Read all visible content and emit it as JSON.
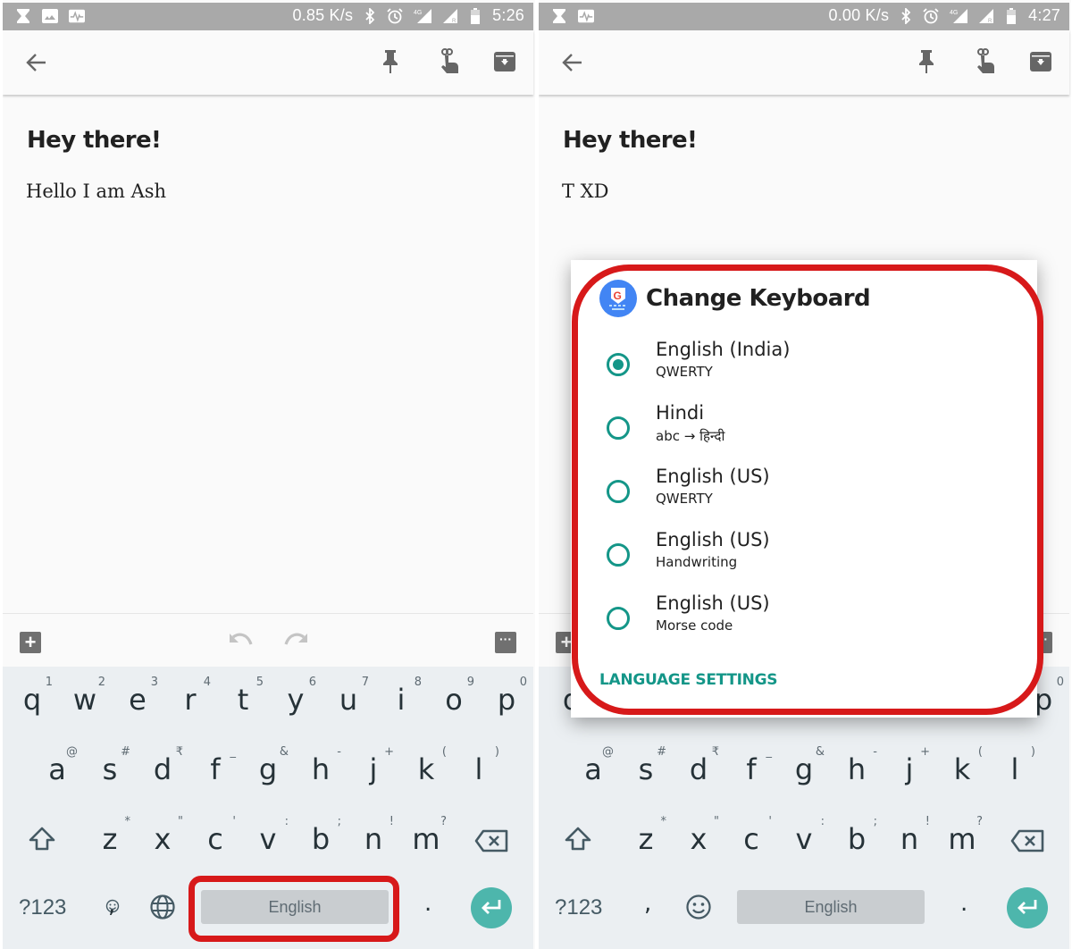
{
  "colors": {
    "accent": "#149688",
    "enter_key": "#4db6ac",
    "highlight": "#d7191a",
    "statusbar": "#a9a9a9",
    "keyboard_bg": "#ebeff2"
  },
  "left": {
    "statusbar": {
      "left_icons": [
        "hourglass-icon",
        "image-icon",
        "activity-icon"
      ],
      "net_speed": "0.85 K/s",
      "right_icons": [
        "bluetooth-icon",
        "alarm-icon",
        "4g-signal-icon",
        "roaming-signal-icon",
        "battery-icon"
      ],
      "network_label": "4G",
      "time": "5:26"
    },
    "toolbar": {
      "icons": [
        "back-arrow-icon",
        "pin-icon",
        "reminder-icon",
        "archive-icon"
      ]
    },
    "note": {
      "title": "Hey there!",
      "body": "Hello I am Ash"
    },
    "keyboard": {
      "row1": [
        {
          "key": "q",
          "hint": "1"
        },
        {
          "key": "w",
          "hint": "2"
        },
        {
          "key": "e",
          "hint": "3"
        },
        {
          "key": "r",
          "hint": "4"
        },
        {
          "key": "t",
          "hint": "5"
        },
        {
          "key": "y",
          "hint": "6"
        },
        {
          "key": "u",
          "hint": "7"
        },
        {
          "key": "i",
          "hint": "8"
        },
        {
          "key": "o",
          "hint": "9"
        },
        {
          "key": "p",
          "hint": "0"
        }
      ],
      "row2": [
        {
          "key": "a",
          "hint": "@"
        },
        {
          "key": "s",
          "hint": "#"
        },
        {
          "key": "d",
          "hint": "₹"
        },
        {
          "key": "f",
          "hint": "_"
        },
        {
          "key": "g",
          "hint": "&"
        },
        {
          "key": "h",
          "hint": "-"
        },
        {
          "key": "j",
          "hint": "+"
        },
        {
          "key": "k",
          "hint": "("
        },
        {
          "key": "l",
          "hint": ")"
        }
      ],
      "row3": [
        {
          "key": "z",
          "hint": "*"
        },
        {
          "key": "x",
          "hint": "\""
        },
        {
          "key": "c",
          "hint": "'"
        },
        {
          "key": "v",
          "hint": ":"
        },
        {
          "key": "b",
          "hint": ";"
        },
        {
          "key": "n",
          "hint": "!"
        },
        {
          "key": "m",
          "hint": "?"
        }
      ],
      "symbols_key": "?123",
      "comma_key": ",",
      "comma_hint_icon": "emoji-icon",
      "globe_icon": "globe-icon",
      "spacebar": "English",
      "period_key": "."
    }
  },
  "right": {
    "statusbar": {
      "left_icons": [
        "hourglass-icon",
        "activity-icon"
      ],
      "net_speed": "0.00 K/s",
      "right_icons": [
        "bluetooth-icon",
        "alarm-icon",
        "4g-signal-icon",
        "roaming-signal-icon",
        "battery-icon"
      ],
      "network_label": "4G",
      "time": "4:27"
    },
    "note": {
      "title": "Hey there!",
      "body": "T XD"
    },
    "dialog": {
      "title": "Change Keyboard",
      "app_icon": "gboard-icon",
      "options": [
        {
          "label": "English (India)",
          "sub": "QWERTY",
          "selected": true
        },
        {
          "label": "Hindi",
          "sub": "abc → हिन्दी",
          "selected": false
        },
        {
          "label": "English (US)",
          "sub": "QWERTY",
          "selected": false
        },
        {
          "label": "English (US)",
          "sub": "Handwriting",
          "selected": false
        },
        {
          "label": "English (US)",
          "sub": "Morse code",
          "selected": false
        }
      ],
      "action": "LANGUAGE SETTINGS"
    },
    "keyboard": {
      "row2": [
        {
          "key": "a",
          "hint": "@"
        },
        {
          "key": "s",
          "hint": "#"
        },
        {
          "key": "d",
          "hint": "₹"
        },
        {
          "key": "f",
          "hint": "_"
        },
        {
          "key": "g",
          "hint": "&"
        },
        {
          "key": "h",
          "hint": "-"
        },
        {
          "key": "j",
          "hint": "+"
        },
        {
          "key": "k",
          "hint": "("
        },
        {
          "key": "l",
          "hint": ")"
        }
      ],
      "row3": [
        {
          "key": "z",
          "hint": "*"
        },
        {
          "key": "x",
          "hint": "\""
        },
        {
          "key": "c",
          "hint": "'"
        },
        {
          "key": "v",
          "hint": ":"
        },
        {
          "key": "b",
          "hint": ";"
        },
        {
          "key": "n",
          "hint": "!"
        },
        {
          "key": "m",
          "hint": "?"
        }
      ],
      "row1_visible_edges": {
        "first": "q",
        "last": "p",
        "last_hint": "0"
      },
      "symbols_key": "?123",
      "comma_key": ",",
      "emoji_icon": "emoji-icon",
      "spacebar": "English",
      "period_key": "."
    }
  }
}
